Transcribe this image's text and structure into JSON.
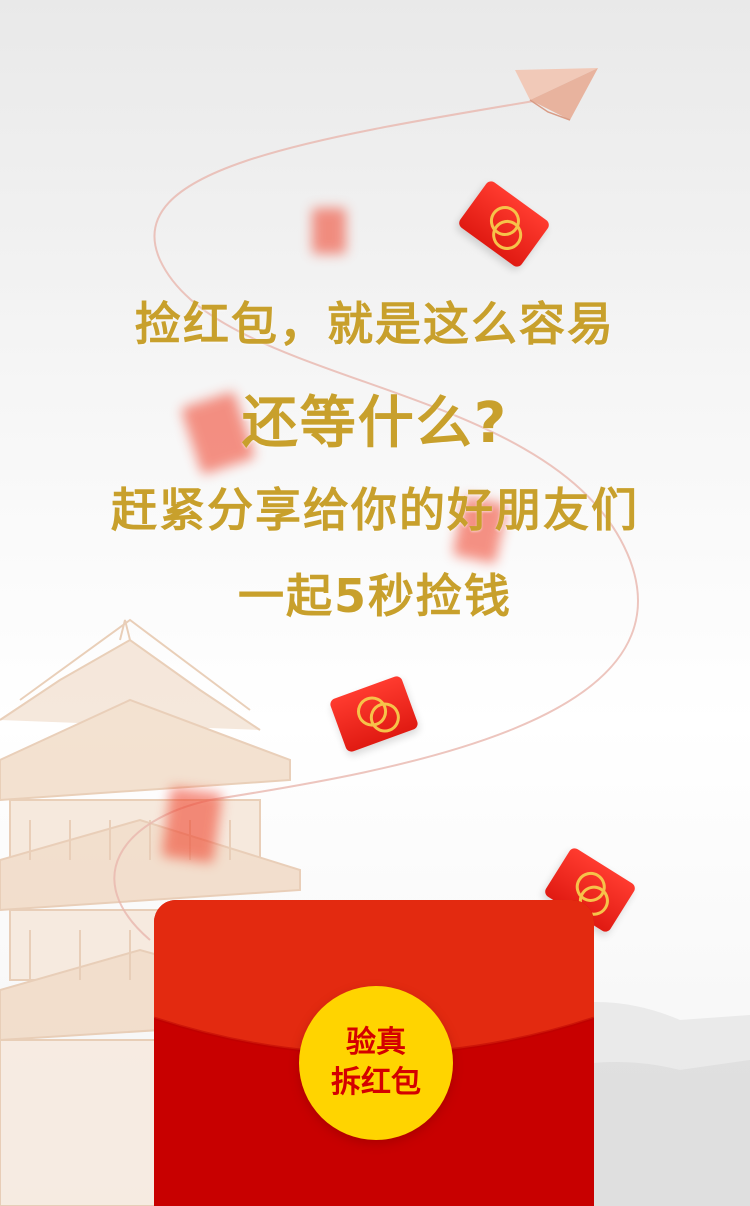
{
  "headline": {
    "line1": "捡红包，就是这么容易",
    "line2": "还等什么?",
    "line3": "赶紧分享给你的好朋友们",
    "line4": "一起5秒捡钱"
  },
  "envelope": {
    "button_line1": "验真",
    "button_line2": "拆红包"
  },
  "colors": {
    "headline": "#c8a02c",
    "envelope": "#c80000",
    "button": "#ffd400",
    "button_text": "#d40000"
  },
  "icons": [
    "paper-plane-icon",
    "red-envelope-icon",
    "pagoda-illustration"
  ]
}
